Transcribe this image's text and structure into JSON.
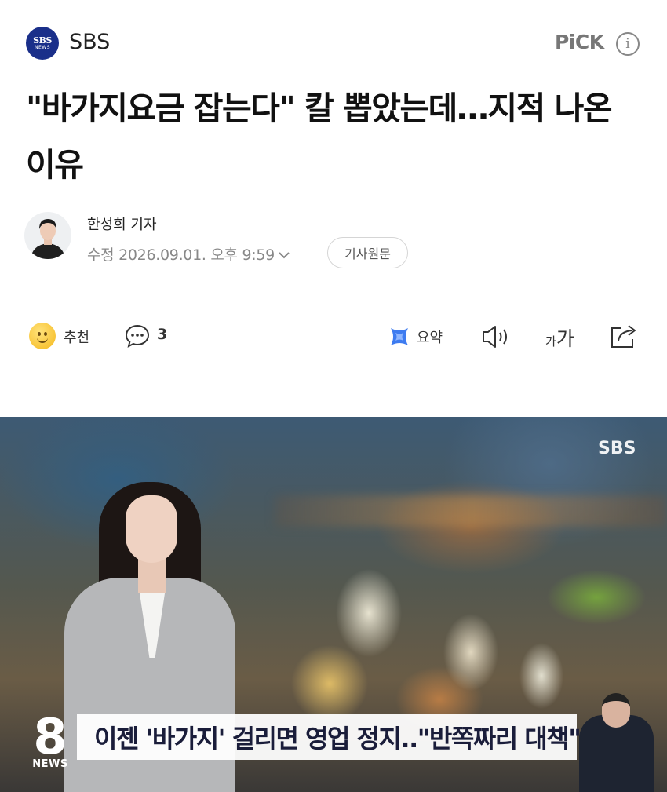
{
  "press": {
    "logo_top": "SBS",
    "logo_bottom": "NEWS",
    "name": "SBS",
    "pick_label": "PiCK",
    "info_icon": "info-icon"
  },
  "article": {
    "headline": "\"바가지요금 잡는다\" 칼 뽑았는데…지적 나온 이유",
    "reporter": "한성희 기자",
    "date": "수정 2026.09.01. 오후 9:59",
    "original_button": "기사원문"
  },
  "actions": {
    "recommend_label": "추천",
    "comment_count": "3",
    "summary_label": "요약",
    "font_small": "가",
    "font_big": "가"
  },
  "image": {
    "watermark": "SBS",
    "channel_number": "8",
    "channel_label": "NEWS",
    "caption": "이젠 '바가지' 걸리면 영업 정지..\"반쪽짜리 대책\""
  },
  "colors": {
    "brand": "#1a2f8a",
    "text": "#111111",
    "muted": "#888888",
    "summary_accent": "#3d7bf0"
  }
}
